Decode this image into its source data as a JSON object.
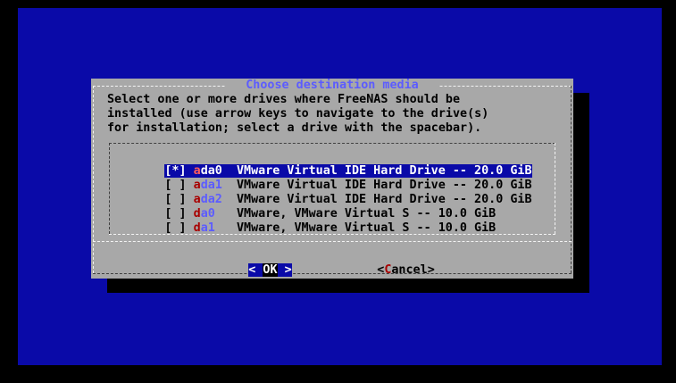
{
  "dialog": {
    "title": "Choose destination media",
    "prompt_lines": [
      "Select one or more drives where FreeNAS should be",
      "installed (use arrow keys to navigate to the drive(s)",
      "for installation; select a drive with the spacebar)."
    ],
    "drives": [
      {
        "checkbox": "[*]",
        "hotkey": "a",
        "name_rest": "da0",
        "description": "VMware Virtual IDE Hard Drive -- 20.0 GiB",
        "checked": true,
        "selected": true
      },
      {
        "checkbox": "[ ]",
        "hotkey": "a",
        "name_rest": "da1",
        "description": "VMware Virtual IDE Hard Drive -- 20.0 GiB",
        "checked": false,
        "selected": false
      },
      {
        "checkbox": "[ ]",
        "hotkey": "a",
        "name_rest": "da2",
        "description": "VMware Virtual IDE Hard Drive -- 20.0 GiB",
        "checked": false,
        "selected": false
      },
      {
        "checkbox": "[ ]",
        "hotkey": "d",
        "name_rest": "a0",
        "description": "VMware, VMware Virtual S -- 10.0 GiB",
        "checked": false,
        "selected": false
      },
      {
        "checkbox": "[ ]",
        "hotkey": "d",
        "name_rest": "a1",
        "description": "VMware, VMware Virtual S -- 10.0 GiB",
        "checked": false,
        "selected": false
      }
    ],
    "ok_button": {
      "left_bracket": "<",
      "hotkey": "O",
      "label_rest": "K",
      "right_bracket": ">"
    },
    "cancel_button": {
      "left_bracket": "<",
      "hotkey": "C",
      "label_rest": "ancel",
      "right_bracket": ">"
    }
  },
  "colors": {
    "screen_background": "#0a0aa8",
    "dialog_background": "#a8a8a8",
    "title_color": "#5c5cff",
    "hotkey_color": "#a80000",
    "selection_background": "#0a0aa8"
  }
}
